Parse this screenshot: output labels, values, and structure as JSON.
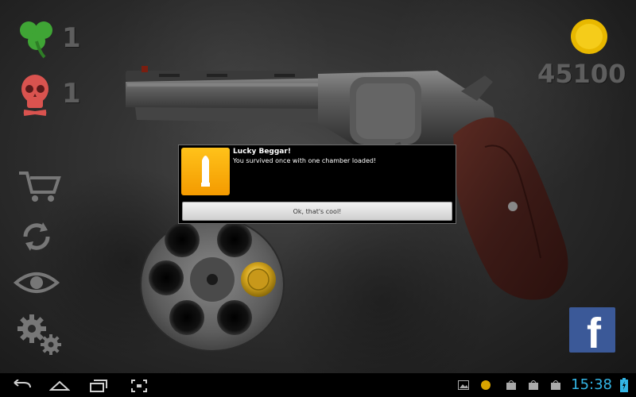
{
  "stats": {
    "luck_count": "1",
    "death_count": "1",
    "coins": "45100"
  },
  "sidebar": {
    "items": [
      {
        "icon": "cart-icon"
      },
      {
        "icon": "refresh-icon"
      },
      {
        "icon": "eye-icon"
      },
      {
        "icon": "gears-icon"
      }
    ]
  },
  "dialog": {
    "title": "Lucky Beggar!",
    "message": "You survived once with one chamber loaded!",
    "ok_label": "Ok, that's cool!",
    "icon": "bullet-icon"
  },
  "cylinder": {
    "chambers_total": 6,
    "chambers_loaded": 1
  },
  "share": {
    "facebook_label": "f"
  },
  "statusbar": {
    "time": "15:38"
  },
  "colors": {
    "accent_clock": "#33b5e5",
    "dialog_icon": "#f7a800",
    "facebook": "#3b5998",
    "coin": "#e8b800",
    "clover": "#3fa535",
    "skull": "#d9534f"
  }
}
